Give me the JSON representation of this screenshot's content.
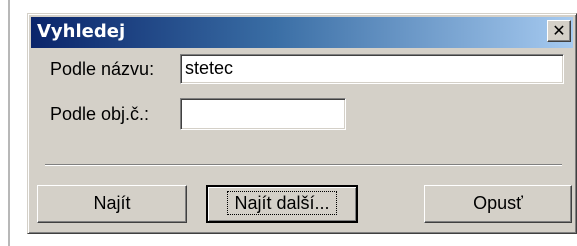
{
  "dialog": {
    "title": "Vyhledej",
    "close_glyph": "✕"
  },
  "form": {
    "name_label": "Podle názvu:",
    "name_value": "stetec",
    "order_label": "Podle obj.č.:",
    "order_value": ""
  },
  "buttons": {
    "find": "Najít",
    "find_next": "Najít další...",
    "leave": "Opusť"
  },
  "colors": {
    "face": "#d4d0c8",
    "title_start": "#0a246a",
    "title_end": "#a6caf0"
  },
  "icons": {
    "close": "close-icon"
  }
}
